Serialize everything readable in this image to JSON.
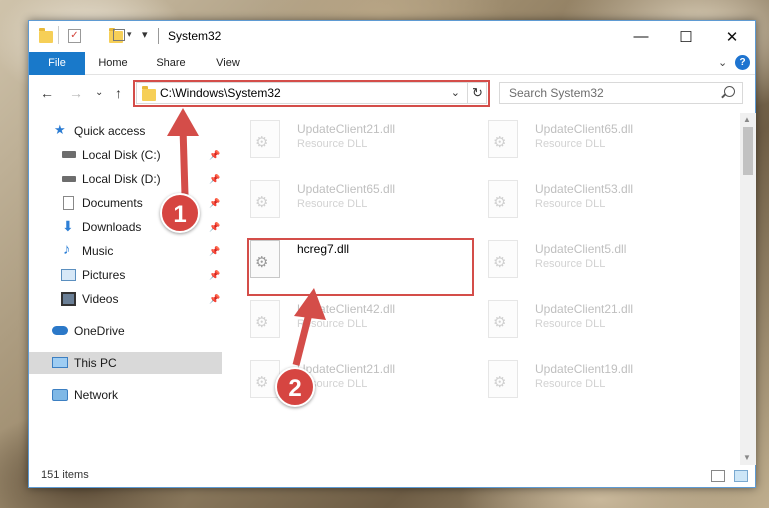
{
  "window": {
    "title": "System32",
    "minimize_glyph": "—",
    "maximize_glyph": "☐",
    "close_glyph": "✕"
  },
  "ribbon": {
    "tabs": [
      "File",
      "Home",
      "Share",
      "View"
    ],
    "expand_glyph": "⌄",
    "help_glyph": "?"
  },
  "navigation": {
    "back_glyph": "←",
    "forward_glyph": "→",
    "recent_glyph": "⌄",
    "up_glyph": "↑",
    "address": "C:\\Windows\\System32",
    "address_dropdown_glyph": "⌄",
    "refresh_glyph": "↻",
    "search_placeholder": "Search System32"
  },
  "sidebar": {
    "items": [
      {
        "label": "Quick access",
        "icon": "star-icon",
        "pinned": false
      },
      {
        "label": "Local Disk (C:)",
        "icon": "drive-icon",
        "pinned": true
      },
      {
        "label": "Local Disk (D:)",
        "icon": "drive-icon",
        "pinned": true
      },
      {
        "label": "Documents",
        "icon": "document-icon",
        "pinned": true
      },
      {
        "label": "Downloads",
        "icon": "download-icon",
        "pinned": true
      },
      {
        "label": "Music",
        "icon": "music-icon",
        "pinned": true
      },
      {
        "label": "Pictures",
        "icon": "pictures-icon",
        "pinned": true
      },
      {
        "label": "Videos",
        "icon": "video-icon",
        "pinned": true
      },
      {
        "label": "OneDrive",
        "icon": "cloud-icon",
        "pinned": false
      },
      {
        "label": "This PC",
        "icon": "computer-icon",
        "pinned": false,
        "selected": true
      },
      {
        "label": "Network",
        "icon": "network-icon",
        "pinned": false
      }
    ],
    "pin_glyph": "📌"
  },
  "files": {
    "left_column": [
      {
        "name": "UpdateClient21.dll",
        "type": "Resource DLL"
      },
      {
        "name": "UpdateClient65.dll",
        "type": "Resource DLL"
      },
      {
        "name": "hcreg7.dll",
        "type": ""
      },
      {
        "name": "UpdateClient42.dll",
        "type": "Resource DLL"
      },
      {
        "name": "UpdateClient21.dll",
        "type": "Resource DLL"
      }
    ],
    "right_column": [
      {
        "name": "UpdateClient65.dll",
        "type": "Resource DLL"
      },
      {
        "name": "UpdateClient53.dll",
        "type": "Resource DLL"
      },
      {
        "name": "UpdateClient5.dll",
        "type": "Resource DLL"
      },
      {
        "name": "UpdateClient21.dll",
        "type": "Resource DLL"
      },
      {
        "name": "UpdateClient19.dll",
        "type": "Resource DLL"
      }
    ]
  },
  "status": {
    "item_count": "151 items"
  },
  "callouts": [
    "1",
    "2"
  ],
  "colors": {
    "accent": "#1979ca",
    "highlight": "#d44d49",
    "callout": "#d64541"
  }
}
